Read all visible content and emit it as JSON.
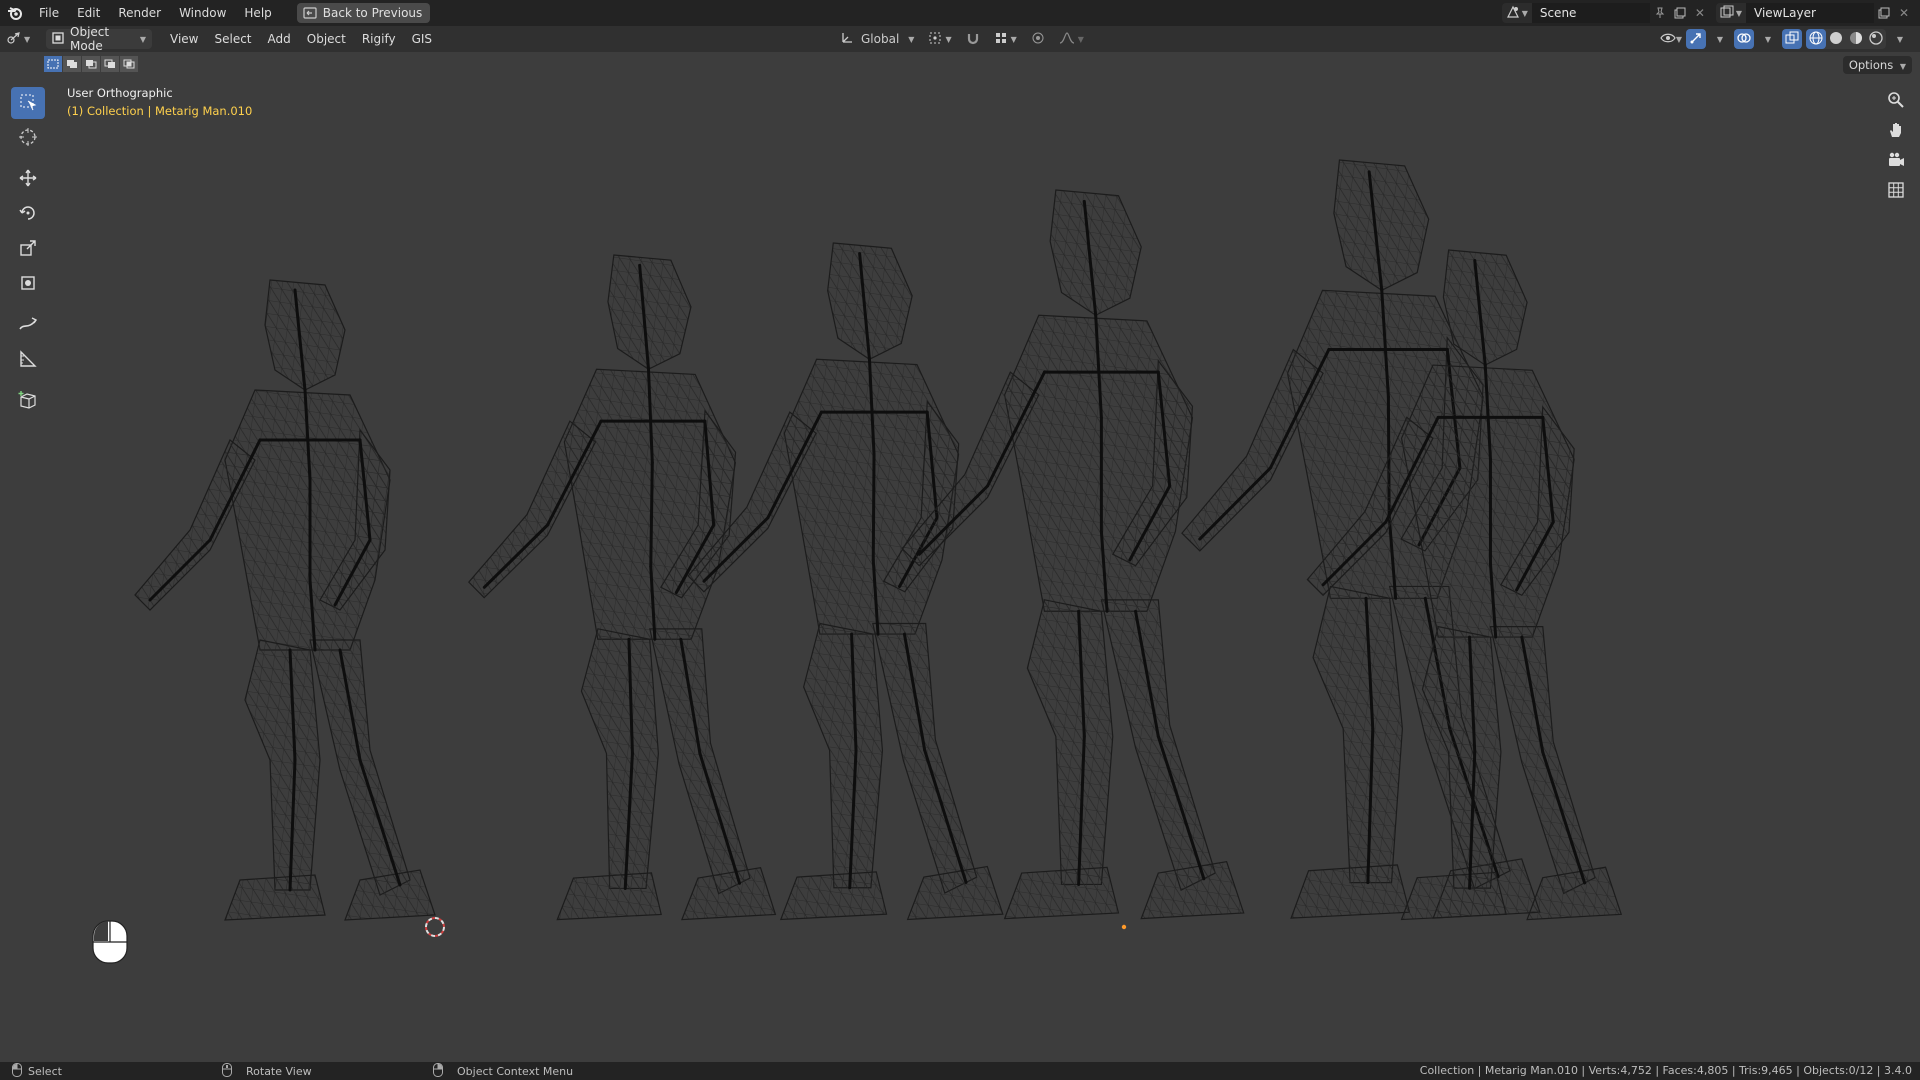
{
  "menu": {
    "items": [
      "File",
      "Edit",
      "Render",
      "Window",
      "Help"
    ],
    "back_button": "Back to Previous"
  },
  "scene": {
    "name": "Scene"
  },
  "view_layer": {
    "name": "ViewLayer"
  },
  "viewport_header": {
    "mode": "Object Mode",
    "menus": [
      "View",
      "Select",
      "Add",
      "Object",
      "Rigify",
      "GIS"
    ],
    "transform_orientation": "Global",
    "options_label": "Options"
  },
  "viewport": {
    "view_name": "User Orthographic",
    "collection_info": "(1) Collection | Metarig Man.010"
  },
  "status_bar": {
    "left_click": "Select",
    "middle_click": "Rotate View",
    "right_click": "Object Context Menu",
    "stats": "Collection | Metarig Man.010 | Verts:4,752 | Faces:4,805 | Tris:9,465 | Objects:0/12 | 3.4.0"
  },
  "colors": {
    "accent": "#4772b3",
    "collection_text": "#ffd14d",
    "viewport_bg": "#3d3d3d",
    "wire": "#1c1c1c"
  },
  "icons": {
    "toolbar": [
      "select-box-icon",
      "cursor-icon",
      "move-icon",
      "rotate-icon",
      "scale-icon",
      "transform-icon",
      "annotate-icon",
      "measure-icon",
      "add-cube-icon"
    ],
    "nav": [
      "zoom-icon",
      "pan-hand-icon",
      "camera-icon",
      "grid-view-icon"
    ]
  }
}
